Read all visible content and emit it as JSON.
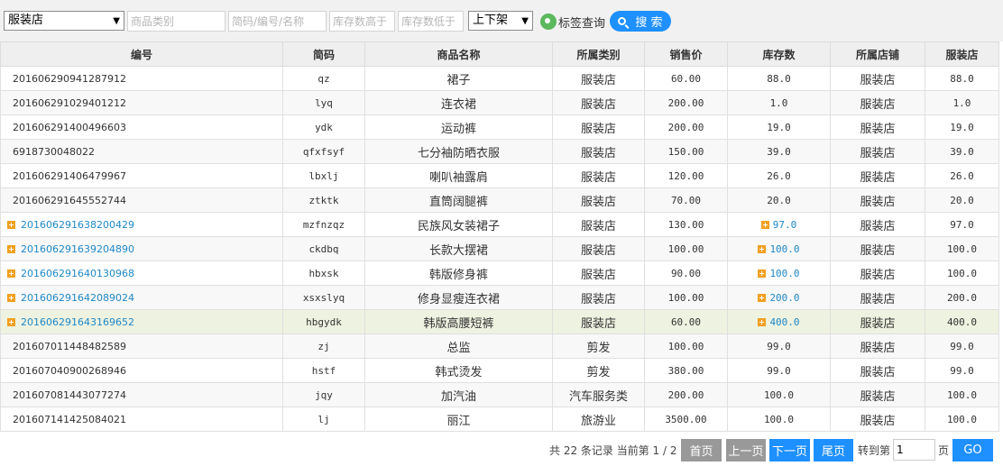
{
  "filters": {
    "store_select": "服装店",
    "category_placeholder": "商品类别",
    "code_placeholder": "简码/编号/名称",
    "stock_above_placeholder": "库存数高于",
    "stock_below_placeholder": "库存数低于",
    "shelf_select": "上下架",
    "tag_query": "标签查询",
    "search_label": "搜 索"
  },
  "table": {
    "headers": [
      "编号",
      "简码",
      "商品名称",
      "所属类别",
      "销售价",
      "库存数",
      "所属店铺",
      "服装店"
    ],
    "rows": [
      {
        "code": "20160629094128791​2",
        "abbr": "qz",
        "name": "裙子",
        "category": "服装店",
        "price": "60.00",
        "stock": "88.0",
        "shop": "服装店",
        "store_stock": "88.0",
        "expandable": false
      },
      {
        "code": "201606291029401212",
        "abbr": "lyq",
        "name": "连衣裙",
        "category": "服装店",
        "price": "200.00",
        "stock": "1.0",
        "shop": "服装店",
        "store_stock": "1.0",
        "expandable": false
      },
      {
        "code": "201606291400496603",
        "abbr": "ydk",
        "name": "运动裤",
        "category": "服装店",
        "price": "200.00",
        "stock": "19.0",
        "shop": "服装店",
        "store_stock": "19.0",
        "expandable": false
      },
      {
        "code": "6918730048022",
        "abbr": "qfxfsyf",
        "name": "七分袖防晒衣服",
        "category": "服装店",
        "price": "150.00",
        "stock": "39.0",
        "shop": "服装店",
        "store_stock": "39.0",
        "expandable": false
      },
      {
        "code": "201606291406479967",
        "abbr": "lbxlj",
        "name": "喇叭袖露肩",
        "category": "服装店",
        "price": "120.00",
        "stock": "26.0",
        "shop": "服装店",
        "store_stock": "26.0",
        "expandable": false
      },
      {
        "code": "201606291645552744",
        "abbr": "ztktk",
        "name": "直筒阔腿裤",
        "category": "服装店",
        "price": "70.00",
        "stock": "20.0",
        "shop": "服装店",
        "store_stock": "20.0",
        "expandable": false
      },
      {
        "code": "201606291638200429",
        "abbr": "mzfnzqz",
        "name": "民族风女装裙子",
        "category": "服装店",
        "price": "130.00",
        "stock": "97.0",
        "shop": "服装店",
        "store_stock": "97.0",
        "expandable": true
      },
      {
        "code": "201606291639204890",
        "abbr": "ckdbq",
        "name": "长款大摆裙",
        "category": "服装店",
        "price": "100.00",
        "stock": "100.0",
        "shop": "服装店",
        "store_stock": "100.0",
        "expandable": true
      },
      {
        "code": "201606291640130968",
        "abbr": "hbxsk",
        "name": "韩版修身裤",
        "category": "服装店",
        "price": "90.00",
        "stock": "100.0",
        "shop": "服装店",
        "store_stock": "100.0",
        "expandable": true
      },
      {
        "code": "201606291642089024",
        "abbr": "xsxslyq",
        "name": "修身显瘦连衣裙",
        "category": "服装店",
        "price": "100.00",
        "stock": "200.0",
        "shop": "服装店",
        "store_stock": "200.0",
        "expandable": true
      },
      {
        "code": "201606291643169652",
        "abbr": "hbgydk",
        "name": "韩版高腰短裤",
        "category": "服装店",
        "price": "60.00",
        "stock": "400.0",
        "shop": "服装店",
        "store_stock": "400.0",
        "expandable": true
      },
      {
        "code": "201607011448482589",
        "abbr": "zj",
        "name": "总监",
        "category": "剪发",
        "price": "100.00",
        "stock": "99.0",
        "shop": "服装店",
        "store_stock": "99.0",
        "expandable": false
      },
      {
        "code": "201607040900268946",
        "abbr": "hstf",
        "name": "韩式烫发",
        "category": "剪发",
        "price": "380.00",
        "stock": "99.0",
        "shop": "服装店",
        "store_stock": "99.0",
        "expandable": false
      },
      {
        "code": "201607081443077274",
        "abbr": "jqy",
        "name": "加汽油",
        "category": "汽车服务类",
        "price": "200.00",
        "stock": "100.0",
        "shop": "服装店",
        "store_stock": "100.0",
        "expandable": false
      },
      {
        "code": "201607141425084021",
        "abbr": "lj",
        "name": "丽江",
        "category": "旅游业",
        "price": "3500.00",
        "stock": "100.0",
        "shop": "服装店",
        "store_stock": "100.0",
        "expandable": false
      }
    ]
  },
  "pager": {
    "info": "共 22 条记录 当前第 1 / 2",
    "first": "首页",
    "prev": "上一页",
    "next": "下一页",
    "last": "尾页",
    "goto": "转到第",
    "page_value": "1",
    "page_unit": "页",
    "go": "GO"
  },
  "colors": {
    "accent": "#1e90ff",
    "link": "#1e88c8",
    "expand_icon": "#f0a020",
    "tag_icon": "#5cb85c",
    "highlight_row": "#eef2e0"
  }
}
